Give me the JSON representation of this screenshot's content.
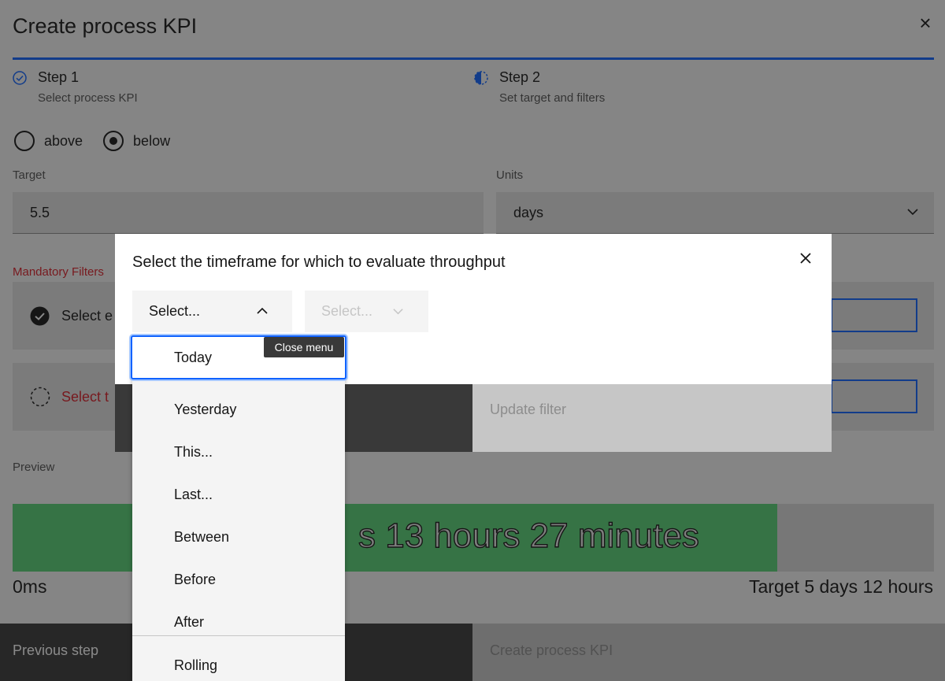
{
  "page": {
    "title": "Create process KPI",
    "steps": [
      {
        "title": "Step 1",
        "subtitle": "Select process KPI",
        "status": "complete"
      },
      {
        "title": "Step 2",
        "subtitle": "Set target and filters",
        "status": "current"
      }
    ],
    "radio": {
      "options": [
        "above",
        "below"
      ],
      "selected": "below"
    },
    "target": {
      "label": "Target",
      "value": "5.5"
    },
    "units": {
      "label": "Units",
      "value": "days"
    },
    "mandatory_filters_label": "Mandatory Filters",
    "filters": [
      {
        "label": "Select e",
        "status": "complete"
      },
      {
        "label": "Select t",
        "status": "pending"
      }
    ],
    "preview": {
      "label": "Preview",
      "bar_text": "s 13 hours 27 minutes",
      "fill_fraction": 0.83,
      "min_label": "0ms",
      "target_label": "Target 5 days 12 hours"
    },
    "footer": {
      "previous": "Previous step",
      "create": "Create process KPI"
    },
    "colors": {
      "accent": "#0f62fe",
      "bar": "#57d175",
      "error": "#da1e28"
    }
  },
  "modal": {
    "title": "Select the timeframe for which to evaluate throughput",
    "dropdown1": {
      "placeholder": "Select...",
      "open": true
    },
    "dropdown2": {
      "placeholder": "Select...",
      "disabled": true
    },
    "update_filter": "Update filter",
    "tooltip": "Close menu",
    "menu_items": [
      "Today",
      "Yesterday",
      "This...",
      "Last...",
      "Between",
      "Before",
      "After",
      "Rolling"
    ],
    "focused_item": "Today"
  }
}
